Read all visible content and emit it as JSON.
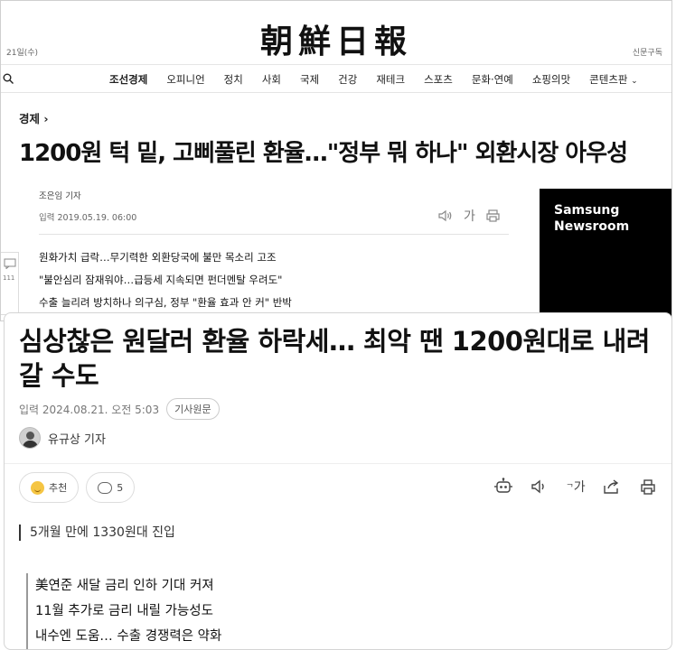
{
  "top_article": {
    "date": "21일(수)",
    "logo": "朝鮮日報",
    "subscribe": "신문구독",
    "nav": [
      {
        "label": "조선경제",
        "active": true
      },
      {
        "label": "오피니언"
      },
      {
        "label": "정치"
      },
      {
        "label": "사회"
      },
      {
        "label": "국제"
      },
      {
        "label": "건강"
      },
      {
        "label": "재테크"
      },
      {
        "label": "스포츠"
      },
      {
        "label": "문화·연예"
      },
      {
        "label": "쇼핑의맛"
      },
      {
        "label": "콘텐츠판"
      }
    ],
    "section": "경제 ›",
    "headline": "1200원 턱 밑, 고삐풀린 환율…\"정부 뭐 하나\" 외환시장 아우성",
    "reporter": "조은임 기자",
    "published": "입력 2019.05.19. 06:00",
    "font_button": "가",
    "summary": [
      "원화가치 급락…무기력한 외환당국에 불만 목소리 고조",
      "\"불안심리 잠재워야…급등세 지속되면 펀더멘탈 우려도\"",
      "수출 늘리려 방치하나 의구심, 정부 \"환율 효과 안 커\" 반박"
    ],
    "side_count": "111",
    "ad": {
      "line1": "Samsung",
      "line2": "Newsroom",
      "bg": "#000000"
    }
  },
  "bottom_article": {
    "headline": "심상찮은 원달러 환율 하락세… 최악 땐 1200원대로 내려 갈 수도",
    "published": "입력 2024.08.21. 오전 5:03",
    "original_button": "기사원문",
    "author": "유규상 기자",
    "like_label": "추천",
    "comment_count": "5",
    "font_label": "가",
    "subheadline": "5개월 만에 1330원대 진입",
    "points": [
      "美연준 새달 금리 인하 기대 커져",
      "11월 추가로 금리 내릴 가능성도",
      "내수엔 도움… 수출 경쟁력은 약화"
    ]
  }
}
